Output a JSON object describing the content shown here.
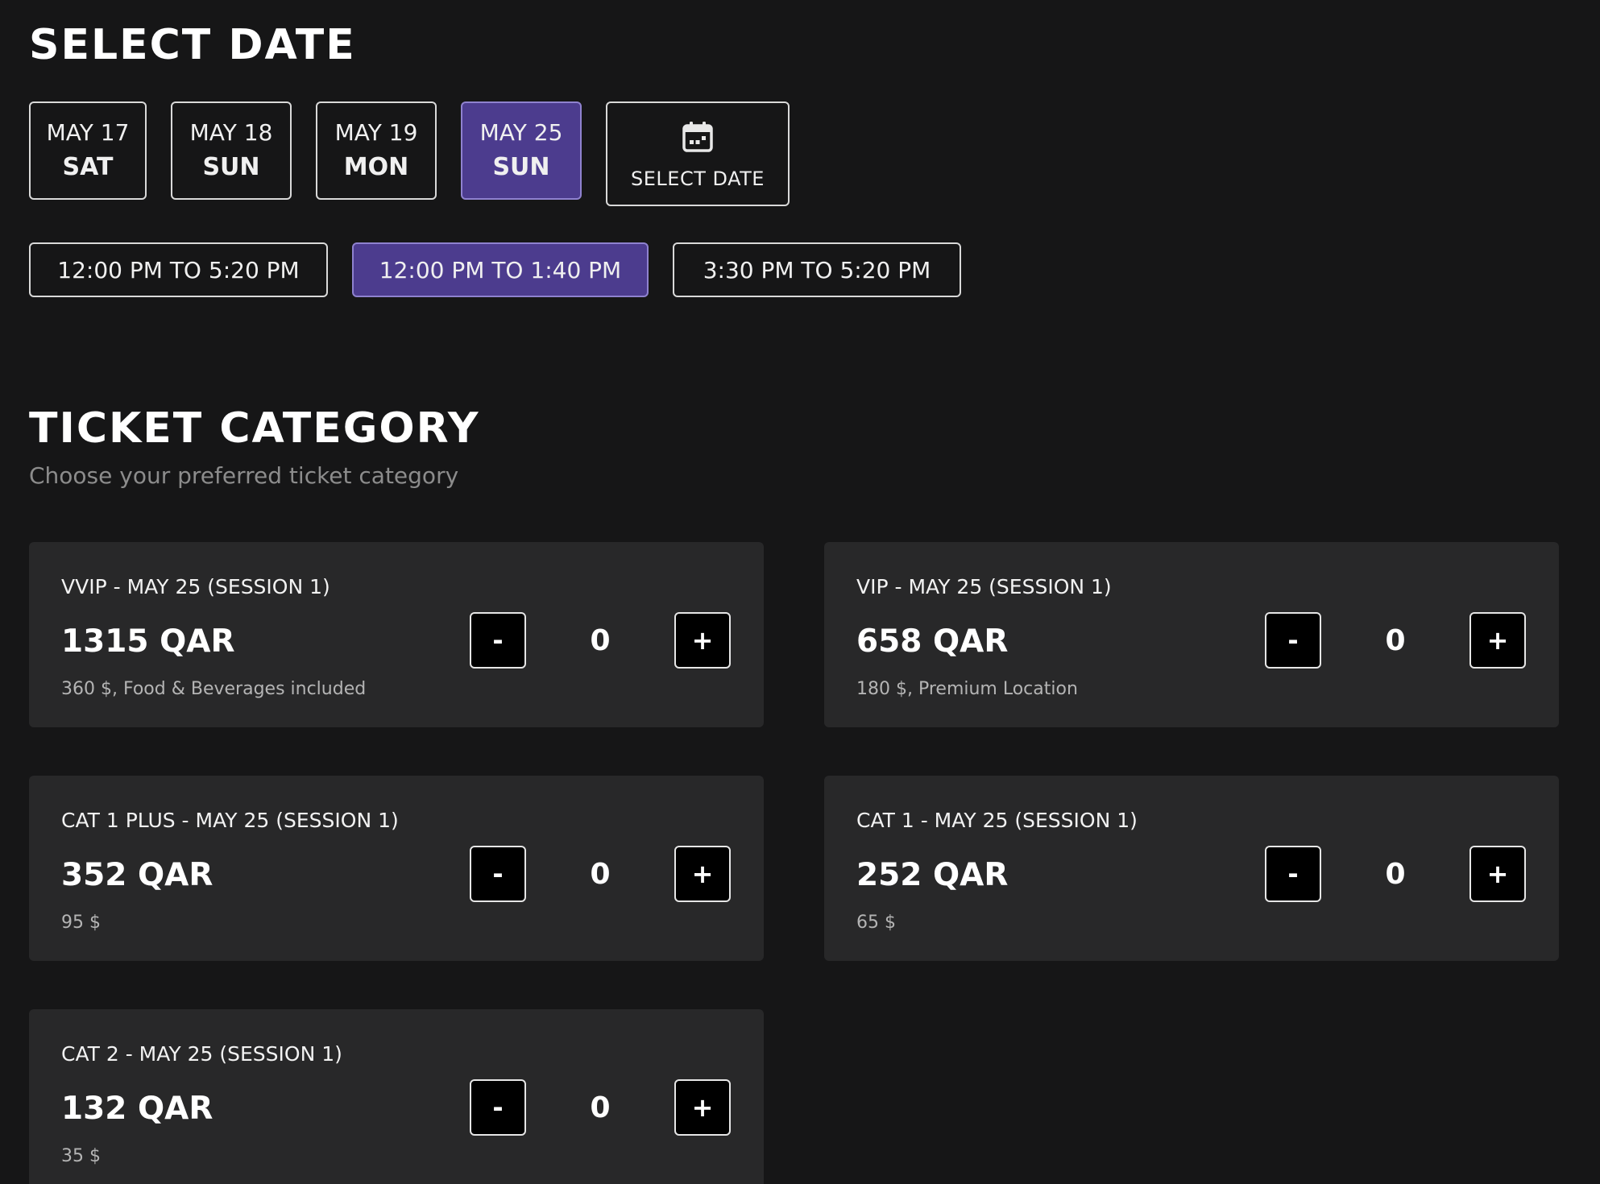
{
  "select_date": {
    "title": "SELECT DATE",
    "dates": [
      {
        "month": "MAY 17",
        "day": "SAT"
      },
      {
        "month": "MAY 18",
        "day": "SUN"
      },
      {
        "month": "MAY 19",
        "day": "MON"
      },
      {
        "month": "MAY 25",
        "day": "SUN"
      }
    ],
    "selected_date_index": 3,
    "picker_label": "SELECT DATE",
    "picker_icon": "calendar-icon"
  },
  "time_slots": {
    "slots": [
      "12:00 PM TO 5:20 PM",
      "12:00 PM TO 1:40 PM",
      "3:30 PM TO 5:20 PM"
    ],
    "selected_index": 1
  },
  "ticket_category": {
    "title": "TICKET CATEGORY",
    "subtitle": "Choose your preferred ticket category",
    "minus_label": "-",
    "plus_label": "+",
    "tickets": [
      {
        "name": "VVIP - MAY 25 (SESSION 1)",
        "price": "1315 QAR",
        "description": "360 $, Food & Beverages included",
        "quantity": "0"
      },
      {
        "name": "VIP - MAY 25 (SESSION 1)",
        "price": "658 QAR",
        "description": "180 $, Premium Location",
        "quantity": "0"
      },
      {
        "name": "CAT 1 PLUS - MAY 25 (SESSION 1)",
        "price": "352 QAR",
        "description": "95 $",
        "quantity": "0"
      },
      {
        "name": "CAT 1 - MAY 25 (SESSION 1)",
        "price": "252 QAR",
        "description": "65 $",
        "quantity": "0"
      },
      {
        "name": "CAT 2 - MAY 25 (SESSION 1)",
        "price": "132 QAR",
        "description": "35 $",
        "quantity": "0"
      }
    ]
  },
  "colors": {
    "background": "#161617",
    "card": "#282829",
    "accent": "#4c3c8e",
    "accent_border": "#8f82cf"
  }
}
